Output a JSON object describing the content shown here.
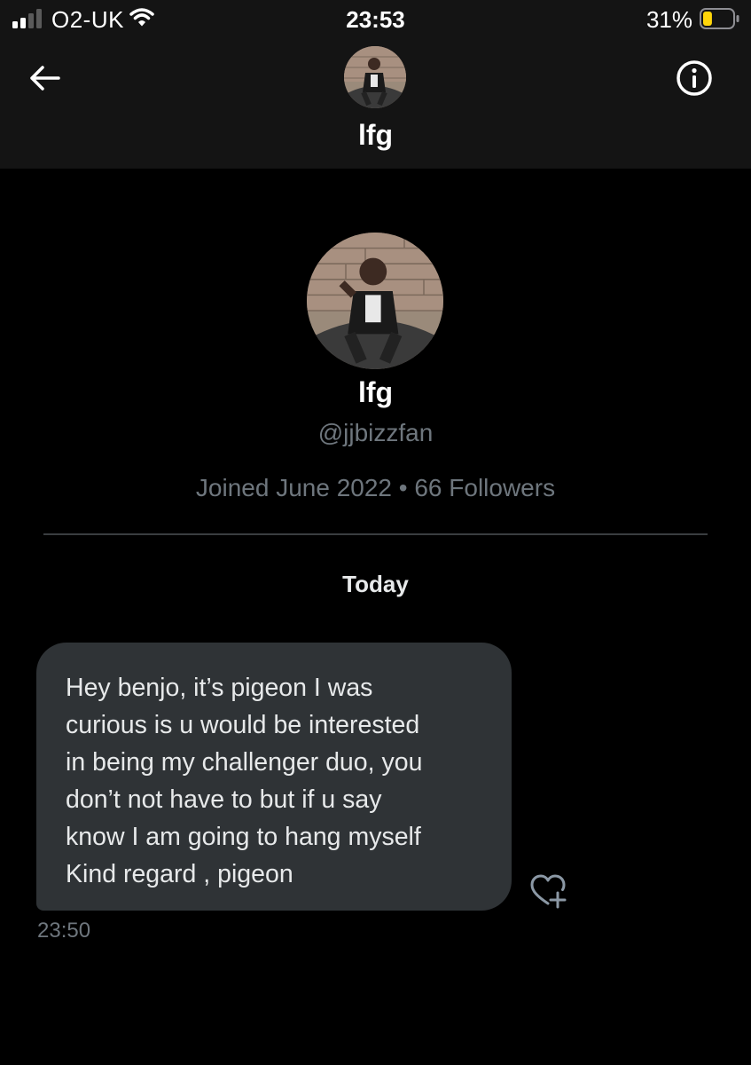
{
  "status_bar": {
    "carrier": "O2-UK",
    "time": "23:53",
    "battery_percent": "31%",
    "battery_level": 0.31,
    "battery_color": "#ffd60a",
    "icons": [
      "signal-icon",
      "wifi-icon",
      "battery-icon"
    ]
  },
  "header": {
    "title": "lfg",
    "icons": [
      "back-arrow-icon",
      "info-icon"
    ]
  },
  "profile": {
    "name": "lfg",
    "handle": "@jjbizzfan",
    "meta": "Joined June 2022 • 66 Followers"
  },
  "conversation": {
    "date_separator": "Today",
    "messages": [
      {
        "text": "Hey benjo, it’s pigeon I was\ncurious is u would be interested\nin being my challenger duo, you\ndon’t not have to but if u say\nknow I am going to hang myself\nKind regard , pigeon",
        "time": "23:50",
        "react_icon": "heart-plus-icon"
      }
    ]
  },
  "colors": {
    "background": "#000000",
    "header_bg": "#141414",
    "bubble_bg": "#2f3336",
    "secondary_text": "#6e767d"
  }
}
